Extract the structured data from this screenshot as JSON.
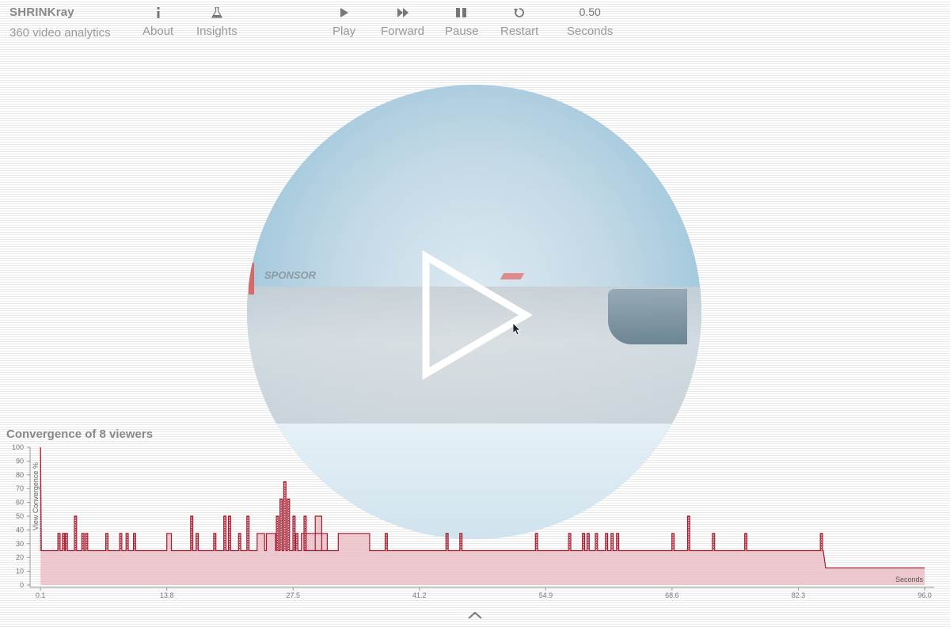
{
  "app": {
    "title": "SHRINKray",
    "subtitle": "360 video analytics"
  },
  "nav": [
    {
      "id": "about",
      "label": "About",
      "icon": "info-icon"
    },
    {
      "id": "insights",
      "label": "Insights",
      "icon": "flask-icon"
    }
  ],
  "controls": [
    {
      "id": "play",
      "label": "Play",
      "icon": "play-icon"
    },
    {
      "id": "forward",
      "label": "Forward",
      "icon": "fast-forward-icon"
    },
    {
      "id": "pause",
      "label": "Pause",
      "icon": "pause-icon"
    },
    {
      "id": "restart",
      "label": "Restart",
      "icon": "restart-icon"
    }
  ],
  "seconds": {
    "value": "0.50",
    "label": "Seconds"
  },
  "video": {
    "sponsor_text": "SPONSOR"
  },
  "colors": {
    "accent": "#a51c30",
    "fill": "#e8b7bf",
    "sphere_edge": "#6aaecd"
  },
  "chart_title": "Convergence of 8 viewers",
  "chart_data": {
    "type": "area",
    "title": "Convergence of 8 viewers",
    "xlabel": "Seconds",
    "ylabel": "View Convergence %",
    "xlim": [
      0,
      96.0
    ],
    "ylim": [
      0,
      100
    ],
    "x_ticks": [
      "0.1",
      "13.8",
      "27.5",
      "41.2",
      "54.9",
      "68.6",
      "82.3",
      "96.0"
    ],
    "y_ticks": [
      0,
      10,
      20,
      30,
      40,
      50,
      60,
      70,
      80,
      90,
      100
    ],
    "baseline": 25,
    "steps": [
      {
        "x": [
          0.1,
          85.0
        ],
        "y": 25
      },
      {
        "x": [
          85.0,
          96.0
        ],
        "y": 12.5
      }
    ],
    "plateaus": [
      {
        "x": [
          13.8,
          14.3
        ],
        "y": 37.5
      },
      {
        "x": [
          23.6,
          24.4
        ],
        "y": 37.5
      },
      {
        "x": [
          24.6,
          25.6
        ],
        "y": 37.5
      },
      {
        "x": [
          28.4,
          31.2
        ],
        "y": 37.5
      },
      {
        "x": [
          29.9,
          30.6
        ],
        "y": 50
      },
      {
        "x": [
          32.4,
          35.8
        ],
        "y": 37.5
      }
    ],
    "spikes": [
      {
        "x": 0.1,
        "y": 100
      },
      {
        "x": 2.1,
        "y": 37.5
      },
      {
        "x": 2.6,
        "y": 37.5
      },
      {
        "x": 2.9,
        "y": 37.5
      },
      {
        "x": 3.9,
        "y": 50
      },
      {
        "x": 4.7,
        "y": 37.5
      },
      {
        "x": 5.1,
        "y": 37.5
      },
      {
        "x": 7.3,
        "y": 37.5
      },
      {
        "x": 8.8,
        "y": 37.5
      },
      {
        "x": 9.5,
        "y": 37.5
      },
      {
        "x": 10.3,
        "y": 37.5
      },
      {
        "x": 16.5,
        "y": 50
      },
      {
        "x": 17.1,
        "y": 37.5
      },
      {
        "x": 19.0,
        "y": 37.5
      },
      {
        "x": 20.1,
        "y": 50
      },
      {
        "x": 20.6,
        "y": 50
      },
      {
        "x": 21.7,
        "y": 37.5
      },
      {
        "x": 22.6,
        "y": 50
      },
      {
        "x": 25.8,
        "y": 50
      },
      {
        "x": 26.2,
        "y": 62.5
      },
      {
        "x": 26.6,
        "y": 75
      },
      {
        "x": 27.0,
        "y": 62.5
      },
      {
        "x": 27.6,
        "y": 50
      },
      {
        "x": 27.9,
        "y": 37.5
      },
      {
        "x": 28.8,
        "y": 50
      },
      {
        "x": 37.6,
        "y": 37.5
      },
      {
        "x": 44.2,
        "y": 37.5
      },
      {
        "x": 45.7,
        "y": 37.5
      },
      {
        "x": 53.9,
        "y": 37.5
      },
      {
        "x": 57.5,
        "y": 37.5
      },
      {
        "x": 59.0,
        "y": 37.5
      },
      {
        "x": 59.5,
        "y": 37.5
      },
      {
        "x": 60.4,
        "y": 37.5
      },
      {
        "x": 61.5,
        "y": 37.5
      },
      {
        "x": 62.1,
        "y": 37.5
      },
      {
        "x": 62.7,
        "y": 37.5
      },
      {
        "x": 68.7,
        "y": 37.5
      },
      {
        "x": 70.4,
        "y": 50
      },
      {
        "x": 73.1,
        "y": 37.5
      },
      {
        "x": 76.6,
        "y": 37.5
      },
      {
        "x": 84.8,
        "y": 37.5
      }
    ]
  }
}
